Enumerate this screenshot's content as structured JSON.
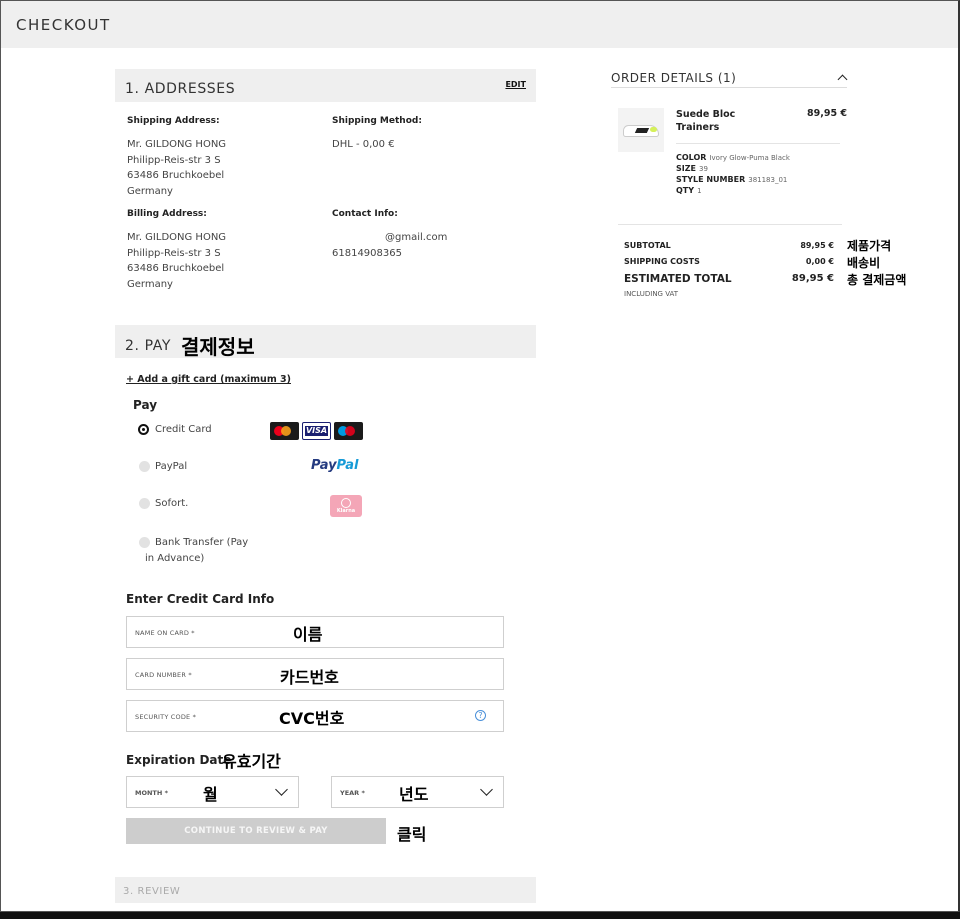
{
  "header": {
    "title": "CHECKOUT"
  },
  "addresses": {
    "title": "1. ADDRESSES",
    "edit_label": "EDIT",
    "shipping_address_label": "Shipping Address:",
    "shipping_address_lines": [
      "Mr. GILDONG HONG",
      "Philipp-Reis-str 3 S",
      "63486 Bruchkoebel",
      "Germany"
    ],
    "shipping_method_label": "Shipping Method:",
    "shipping_method_value": "DHL - 0,00 €",
    "billing_address_label": "Billing Address:",
    "billing_address_lines": [
      "Mr. GILDONG HONG",
      "Philipp-Reis-str 3 S",
      "63486 Bruchkoebel",
      "Germany"
    ],
    "contact_info_label": "Contact Info:",
    "contact_email": "@gmail.com",
    "contact_phone": "61814908365"
  },
  "pay": {
    "title": "2. PAY",
    "annotation": "결제정보",
    "gift_card_link": "+ Add a gift card (maximum 3)",
    "pay_heading": "Pay",
    "options": [
      {
        "label": "Credit Card",
        "selected": true,
        "logo": "card-logos"
      },
      {
        "label": "PayPal",
        "selected": false,
        "logo": "paypal-logo"
      },
      {
        "label": "Sofort.",
        "selected": false,
        "logo": "klarna-logo"
      },
      {
        "label_line1": "Bank Transfer (Pay",
        "label_line2": "in Advance)",
        "selected": false
      }
    ],
    "paypal_logo_part1": "Pay",
    "paypal_logo_part2": "Pal",
    "visa_logo_text": "VISA",
    "klarna_logo_text": "Klarna",
    "credit_card_heading": "Enter Credit Card Info",
    "name_placeholder": "NAME ON CARD *",
    "name_annotation": "이름",
    "card_number_placeholder": "CARD NUMBER *",
    "card_number_annotation": "카드번호",
    "security_code_placeholder": "SECURITY CODE *",
    "security_code_annotation": "CVC번호",
    "help_glyph": "?",
    "expiration_heading": "Expiration Date",
    "expiration_annotation": "유효기간",
    "month_placeholder": "MONTH *",
    "month_annotation": "월",
    "year_placeholder": "YEAR *",
    "year_annotation": "년도",
    "continue_label": "CONTINUE TO REVIEW & PAY",
    "continue_annotation": "클릭"
  },
  "review": {
    "title": "3. REVIEW"
  },
  "order": {
    "title": "ORDER DETAILS (1)",
    "product_name": "Suede Bloc Trainers",
    "product_price": "89,95 €",
    "color_label": "COLOR",
    "color_value": "Ivory Glow-Puma Black",
    "size_label": "SIZE",
    "size_value": "39",
    "style_label": "STYLE NUMBER",
    "style_value": "381183_01",
    "qty_label": "QTY",
    "qty_value": "1",
    "subtotal_label": "SUBTOTAL",
    "subtotal_value": "89,95 €",
    "subtotal_annotation": "제품가격",
    "shipping_label": "SHIPPING COSTS",
    "shipping_value": "0,00 €",
    "shipping_annotation": "배송비",
    "total_label": "ESTIMATED TOTAL",
    "total_value": "89,95 €",
    "total_annotation": "총 결제금액",
    "vat_note": "INCLUDING VAT"
  },
  "colors": {
    "section_bg": "#efefef",
    "button_disabled": "#cdcdcd",
    "paypal_dark": "#253b80",
    "paypal_light": "#179bd7",
    "klarna_pink": "#f4a6b7"
  }
}
